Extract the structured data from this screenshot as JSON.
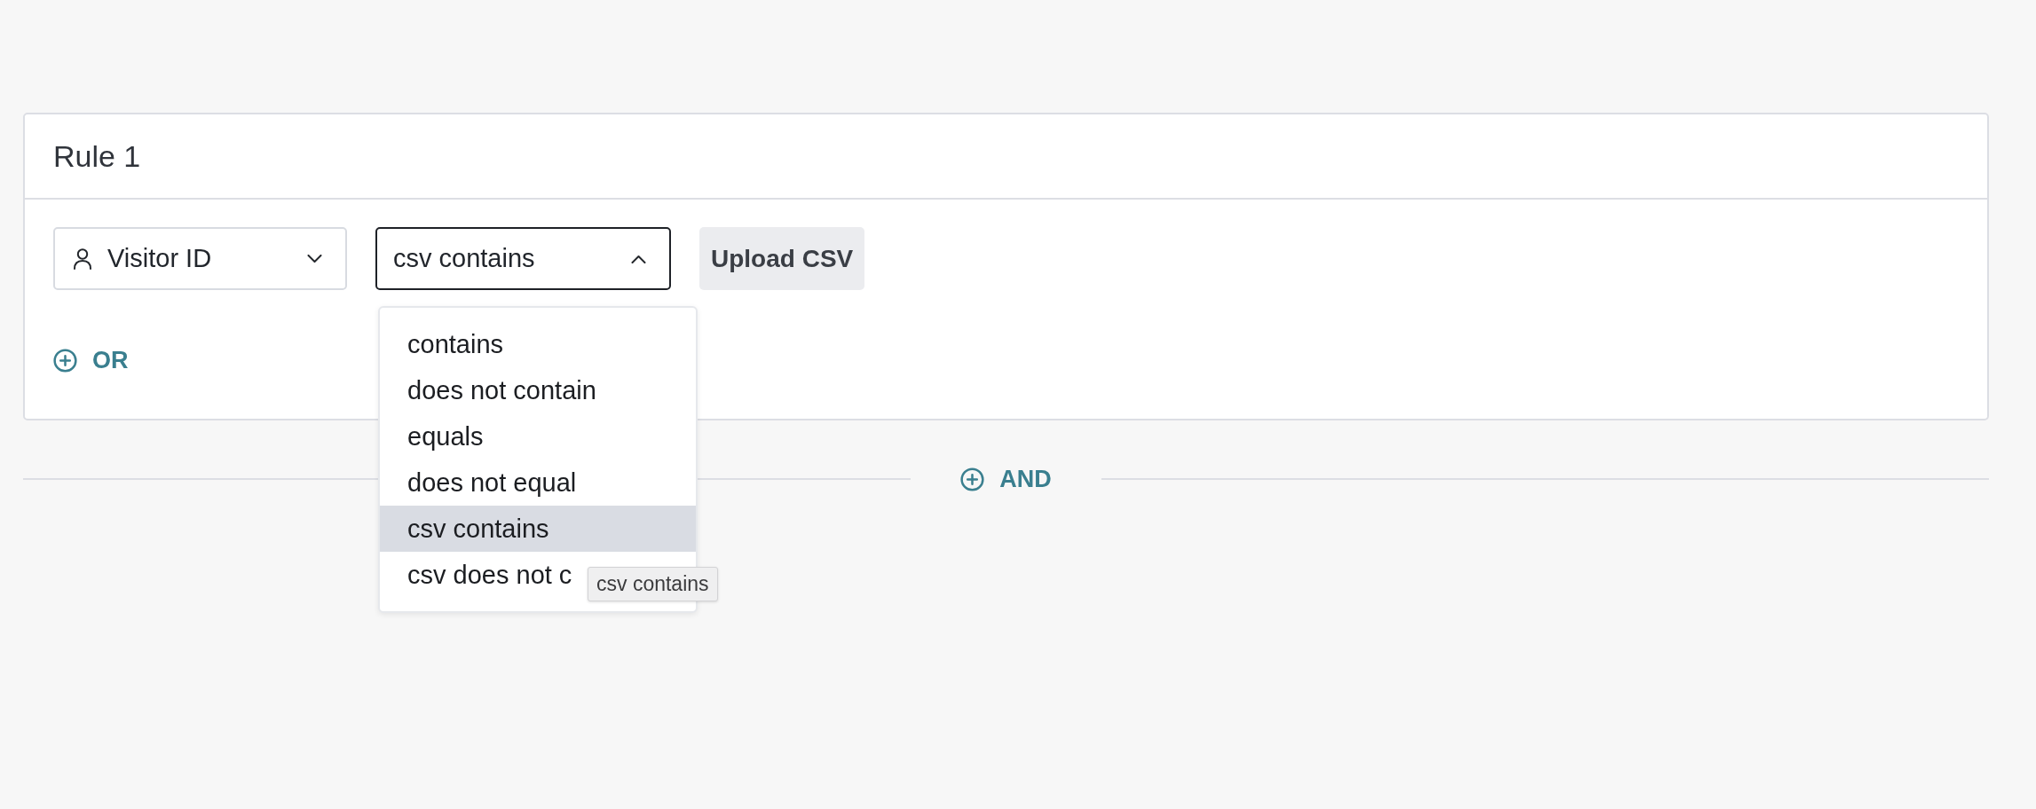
{
  "rules": [
    {
      "title": "Rule 1",
      "conditions": [
        {
          "attribute": {
            "label": "Visitor ID",
            "expanded": false
          },
          "operator": {
            "value": "csv contains",
            "expanded": true,
            "options": [
              {
                "label": "contains",
                "selected": false
              },
              {
                "label": "does not contain",
                "selected": false
              },
              {
                "label": "equals",
                "selected": false
              },
              {
                "label": "does not equal",
                "selected": false
              },
              {
                "label": "csv contains",
                "selected": true
              },
              {
                "label": "csv does not c",
                "selected": false
              }
            ],
            "tooltip": "csv contains"
          },
          "action": "Upload CSV"
        }
      ],
      "or_button": "OR"
    }
  ],
  "and_button": "AND"
}
